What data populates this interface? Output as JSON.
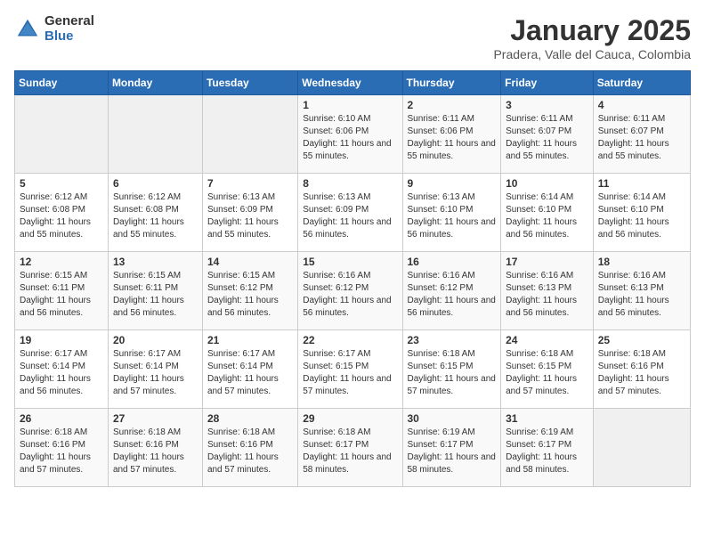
{
  "header": {
    "logo_general": "General",
    "logo_blue": "Blue",
    "title": "January 2025",
    "subtitle": "Pradera, Valle del Cauca, Colombia"
  },
  "days_of_week": [
    "Sunday",
    "Monday",
    "Tuesday",
    "Wednesday",
    "Thursday",
    "Friday",
    "Saturday"
  ],
  "weeks": [
    [
      {
        "day": "",
        "info": ""
      },
      {
        "day": "",
        "info": ""
      },
      {
        "day": "",
        "info": ""
      },
      {
        "day": "1",
        "info": "Sunrise: 6:10 AM\nSunset: 6:06 PM\nDaylight: 11 hours and 55 minutes."
      },
      {
        "day": "2",
        "info": "Sunrise: 6:11 AM\nSunset: 6:06 PM\nDaylight: 11 hours and 55 minutes."
      },
      {
        "day": "3",
        "info": "Sunrise: 6:11 AM\nSunset: 6:07 PM\nDaylight: 11 hours and 55 minutes."
      },
      {
        "day": "4",
        "info": "Sunrise: 6:11 AM\nSunset: 6:07 PM\nDaylight: 11 hours and 55 minutes."
      }
    ],
    [
      {
        "day": "5",
        "info": "Sunrise: 6:12 AM\nSunset: 6:08 PM\nDaylight: 11 hours and 55 minutes."
      },
      {
        "day": "6",
        "info": "Sunrise: 6:12 AM\nSunset: 6:08 PM\nDaylight: 11 hours and 55 minutes."
      },
      {
        "day": "7",
        "info": "Sunrise: 6:13 AM\nSunset: 6:09 PM\nDaylight: 11 hours and 55 minutes."
      },
      {
        "day": "8",
        "info": "Sunrise: 6:13 AM\nSunset: 6:09 PM\nDaylight: 11 hours and 56 minutes."
      },
      {
        "day": "9",
        "info": "Sunrise: 6:13 AM\nSunset: 6:10 PM\nDaylight: 11 hours and 56 minutes."
      },
      {
        "day": "10",
        "info": "Sunrise: 6:14 AM\nSunset: 6:10 PM\nDaylight: 11 hours and 56 minutes."
      },
      {
        "day": "11",
        "info": "Sunrise: 6:14 AM\nSunset: 6:10 PM\nDaylight: 11 hours and 56 minutes."
      }
    ],
    [
      {
        "day": "12",
        "info": "Sunrise: 6:15 AM\nSunset: 6:11 PM\nDaylight: 11 hours and 56 minutes."
      },
      {
        "day": "13",
        "info": "Sunrise: 6:15 AM\nSunset: 6:11 PM\nDaylight: 11 hours and 56 minutes."
      },
      {
        "day": "14",
        "info": "Sunrise: 6:15 AM\nSunset: 6:12 PM\nDaylight: 11 hours and 56 minutes."
      },
      {
        "day": "15",
        "info": "Sunrise: 6:16 AM\nSunset: 6:12 PM\nDaylight: 11 hours and 56 minutes."
      },
      {
        "day": "16",
        "info": "Sunrise: 6:16 AM\nSunset: 6:12 PM\nDaylight: 11 hours and 56 minutes."
      },
      {
        "day": "17",
        "info": "Sunrise: 6:16 AM\nSunset: 6:13 PM\nDaylight: 11 hours and 56 minutes."
      },
      {
        "day": "18",
        "info": "Sunrise: 6:16 AM\nSunset: 6:13 PM\nDaylight: 11 hours and 56 minutes."
      }
    ],
    [
      {
        "day": "19",
        "info": "Sunrise: 6:17 AM\nSunset: 6:14 PM\nDaylight: 11 hours and 56 minutes."
      },
      {
        "day": "20",
        "info": "Sunrise: 6:17 AM\nSunset: 6:14 PM\nDaylight: 11 hours and 57 minutes."
      },
      {
        "day": "21",
        "info": "Sunrise: 6:17 AM\nSunset: 6:14 PM\nDaylight: 11 hours and 57 minutes."
      },
      {
        "day": "22",
        "info": "Sunrise: 6:17 AM\nSunset: 6:15 PM\nDaylight: 11 hours and 57 minutes."
      },
      {
        "day": "23",
        "info": "Sunrise: 6:18 AM\nSunset: 6:15 PM\nDaylight: 11 hours and 57 minutes."
      },
      {
        "day": "24",
        "info": "Sunrise: 6:18 AM\nSunset: 6:15 PM\nDaylight: 11 hours and 57 minutes."
      },
      {
        "day": "25",
        "info": "Sunrise: 6:18 AM\nSunset: 6:16 PM\nDaylight: 11 hours and 57 minutes."
      }
    ],
    [
      {
        "day": "26",
        "info": "Sunrise: 6:18 AM\nSunset: 6:16 PM\nDaylight: 11 hours and 57 minutes."
      },
      {
        "day": "27",
        "info": "Sunrise: 6:18 AM\nSunset: 6:16 PM\nDaylight: 11 hours and 57 minutes."
      },
      {
        "day": "28",
        "info": "Sunrise: 6:18 AM\nSunset: 6:16 PM\nDaylight: 11 hours and 57 minutes."
      },
      {
        "day": "29",
        "info": "Sunrise: 6:18 AM\nSunset: 6:17 PM\nDaylight: 11 hours and 58 minutes."
      },
      {
        "day": "30",
        "info": "Sunrise: 6:19 AM\nSunset: 6:17 PM\nDaylight: 11 hours and 58 minutes."
      },
      {
        "day": "31",
        "info": "Sunrise: 6:19 AM\nSunset: 6:17 PM\nDaylight: 11 hours and 58 minutes."
      },
      {
        "day": "",
        "info": ""
      }
    ]
  ]
}
